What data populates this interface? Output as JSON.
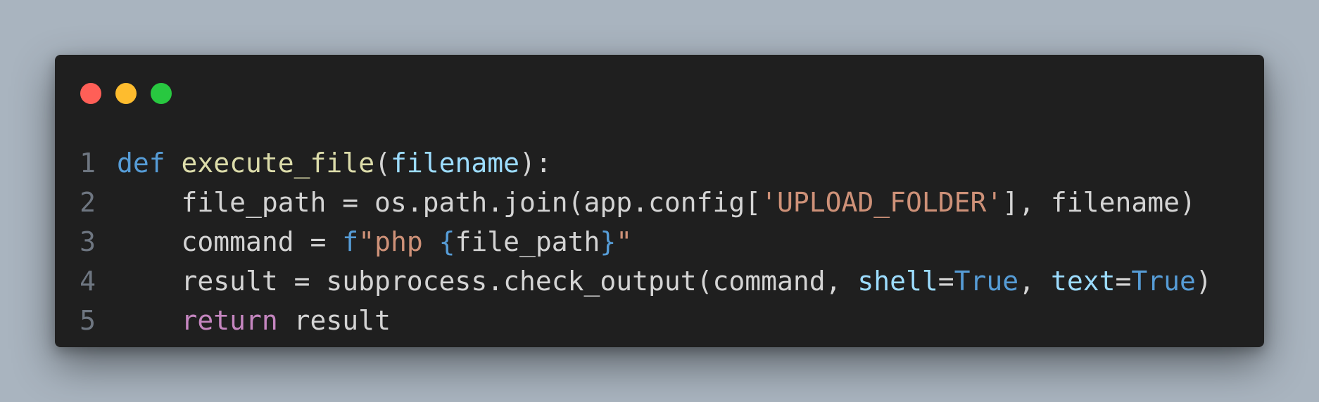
{
  "window": {
    "controls": [
      {
        "name": "close",
        "color": "#ff5f57"
      },
      {
        "name": "minimize",
        "color": "#febc2e"
      },
      {
        "name": "maximize",
        "color": "#28c840"
      }
    ]
  },
  "code": {
    "language": "python",
    "lines": [
      {
        "number": "1",
        "tokens": [
          {
            "text": "def",
            "type": "kw"
          },
          {
            "text": " ",
            "type": "plain"
          },
          {
            "text": "execute_file",
            "type": "fn"
          },
          {
            "text": "(",
            "type": "plain"
          },
          {
            "text": "filename",
            "type": "param"
          },
          {
            "text": "):",
            "type": "plain"
          }
        ]
      },
      {
        "number": "2",
        "tokens": [
          {
            "text": "    file_path = os.path.join(app.config[",
            "type": "plain"
          },
          {
            "text": "'UPLOAD_FOLDER'",
            "type": "str"
          },
          {
            "text": "], filename)",
            "type": "plain"
          }
        ]
      },
      {
        "number": "3",
        "tokens": [
          {
            "text": "    command = ",
            "type": "plain"
          },
          {
            "text": "f",
            "type": "kw"
          },
          {
            "text": "\"php ",
            "type": "str"
          },
          {
            "text": "{",
            "type": "kw"
          },
          {
            "text": "file_path",
            "type": "plain"
          },
          {
            "text": "}",
            "type": "kw"
          },
          {
            "text": "\"",
            "type": "str"
          }
        ]
      },
      {
        "number": "4",
        "tokens": [
          {
            "text": "    result = subprocess.check_output(command, ",
            "type": "plain"
          },
          {
            "text": "shell",
            "type": "param"
          },
          {
            "text": "=",
            "type": "plain"
          },
          {
            "text": "True",
            "type": "kw"
          },
          {
            "text": ", ",
            "type": "plain"
          },
          {
            "text": "text",
            "type": "param"
          },
          {
            "text": "=",
            "type": "plain"
          },
          {
            "text": "True",
            "type": "kw"
          },
          {
            "text": ")",
            "type": "plain"
          }
        ]
      },
      {
        "number": "5",
        "tokens": [
          {
            "text": "    ",
            "type": "plain"
          },
          {
            "text": "return",
            "type": "ctl"
          },
          {
            "text": " result",
            "type": "plain"
          }
        ]
      }
    ]
  },
  "colors": {
    "background": "#a9b4bf",
    "window": "#1f1f1f",
    "keyword": "#569cd6",
    "function": "#dcdcaa",
    "parameter": "#9cdcfe",
    "string": "#ce9178",
    "control": "#c586c0",
    "text": "#d4d4d4",
    "line_number": "#6e7681"
  }
}
